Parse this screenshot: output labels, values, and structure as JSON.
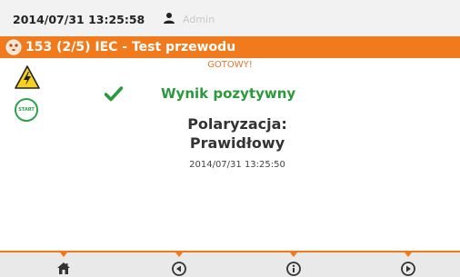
{
  "topbar": {
    "datetime": "2014/07/31 13:25:58",
    "user_icon": "user-icon",
    "user": "Admin"
  },
  "titlebar": {
    "icon": "plug-icon",
    "title": "153 (2/5) IEC - Test przewodu"
  },
  "status": "GOTOWY!",
  "left_icons": {
    "hazard": "high-voltage-warning-icon",
    "start_label": "START"
  },
  "result": {
    "icon": "check-icon",
    "text": "Wynik pozytywny"
  },
  "detail": {
    "line1": "Polaryzacja:",
    "line2": "Prawidłowy",
    "timestamp": "2014/07/31 13:25:50"
  },
  "nav": [
    {
      "icon": "home-icon"
    },
    {
      "icon": "arrow-left-icon"
    },
    {
      "icon": "info-icon"
    },
    {
      "icon": "arrow-right-icon"
    }
  ],
  "colors": {
    "accent": "#f07a1c",
    "success": "#2a9a3a",
    "status": "#e3752a"
  }
}
